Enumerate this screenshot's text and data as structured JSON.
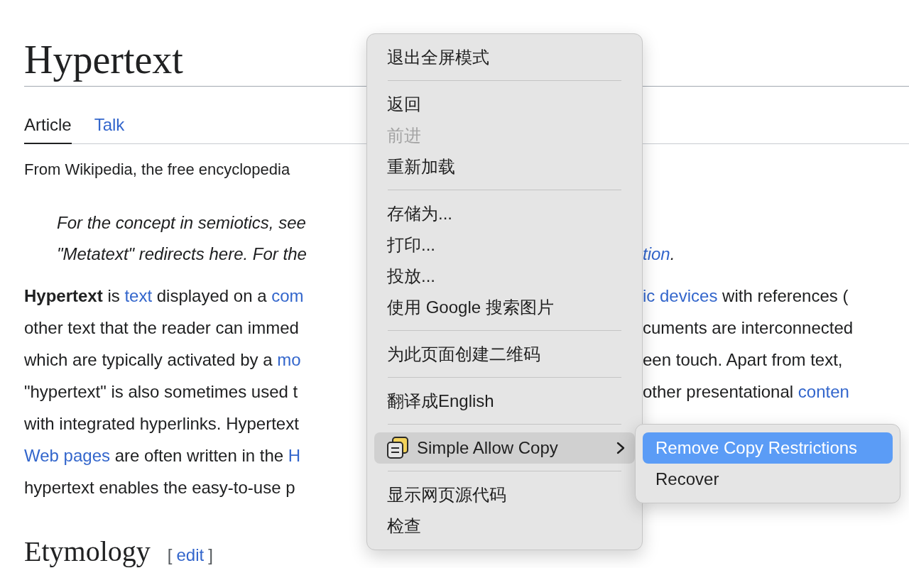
{
  "article": {
    "title": "Hypertext",
    "tabs": [
      {
        "label": "Article",
        "selected": true
      },
      {
        "label": "Talk",
        "selected": false
      }
    ],
    "tagline": "From Wikipedia, the free encyclopedia",
    "hatnote_lines": [
      {
        "left": [
          {
            "kind": "plain",
            "text": "For the concept in semiotics, see"
          }
        ]
      },
      {
        "left": [
          {
            "kind": "plain",
            "text": "\"Metatext\" redirects here. For the"
          }
        ],
        "right": [
          {
            "kind": "link",
            "text": "tion"
          },
          {
            "kind": "plain",
            "text": "."
          }
        ]
      }
    ],
    "paragraph_lines": [
      {
        "left": [
          {
            "kind": "bold",
            "text": "Hypertext"
          },
          {
            "kind": "plain",
            "text": " is "
          },
          {
            "kind": "link",
            "text": "text"
          },
          {
            "kind": "plain",
            "text": " displayed on a "
          },
          {
            "kind": "link",
            "text": "com"
          }
        ],
        "right": [
          {
            "kind": "link",
            "text": "ic devices"
          },
          {
            "kind": "plain",
            "text": " with references ("
          }
        ]
      },
      {
        "left": [
          {
            "kind": "plain",
            "text": "other text that the reader can immed"
          }
        ],
        "right": [
          {
            "kind": "plain",
            "text": "cuments are interconnected"
          }
        ]
      },
      {
        "left": [
          {
            "kind": "plain",
            "text": "which are typically activated by a "
          },
          {
            "kind": "link",
            "text": "mo"
          }
        ],
        "right": [
          {
            "kind": "plain",
            "text": "een touch. Apart from text,"
          }
        ]
      },
      {
        "left": [
          {
            "kind": "plain",
            "text": "\"hypertext\" is also sometimes used t"
          }
        ],
        "right": [
          {
            "kind": "plain",
            "text": "other presentational "
          },
          {
            "kind": "link",
            "text": "conten"
          }
        ]
      },
      {
        "left": [
          {
            "kind": "plain",
            "text": "with integrated hyperlinks. Hypertext"
          }
        ]
      },
      {
        "left": [
          {
            "kind": "link",
            "text": "Web pages"
          },
          {
            "kind": "plain",
            "text": " are often written in the "
          },
          {
            "kind": "link",
            "text": "H"
          }
        ]
      },
      {
        "left": [
          {
            "kind": "plain",
            "text": "hypertext enables the easy-to-use p"
          }
        ]
      }
    ],
    "section": {
      "heading": "Etymology",
      "edit_open": "[",
      "edit_link": "edit",
      "edit_close": "]"
    }
  },
  "context_menu": {
    "groups": [
      [
        {
          "kind": "action",
          "label": "退出全屏模式",
          "disabled": false,
          "selected": false
        }
      ],
      [
        {
          "kind": "action",
          "label": "返回",
          "disabled": false,
          "selected": false
        },
        {
          "kind": "action",
          "label": "前进",
          "disabled": true,
          "selected": false
        },
        {
          "kind": "action",
          "label": "重新加载",
          "disabled": false,
          "selected": false
        }
      ],
      [
        {
          "kind": "action",
          "label": "存储为...",
          "disabled": false,
          "selected": false
        },
        {
          "kind": "action",
          "label": "打印...",
          "disabled": false,
          "selected": false
        },
        {
          "kind": "action",
          "label": "投放...",
          "disabled": false,
          "selected": false
        },
        {
          "kind": "action",
          "label": "使用 Google 搜索图片",
          "disabled": false,
          "selected": false
        }
      ],
      [
        {
          "kind": "action",
          "label": "为此页面创建二维码",
          "disabled": false,
          "selected": false
        }
      ],
      [
        {
          "kind": "action",
          "label": "翻译成English",
          "disabled": false,
          "selected": false
        }
      ],
      [
        {
          "kind": "submenu",
          "label": "Simple Allow Copy",
          "disabled": false,
          "selected": true
        }
      ],
      [
        {
          "kind": "action",
          "label": "显示网页源代码",
          "disabled": false,
          "selected": false
        },
        {
          "kind": "action",
          "label": "检查",
          "disabled": false,
          "selected": false
        }
      ]
    ]
  },
  "submenu": {
    "items": [
      {
        "label": "Remove Copy Restrictions",
        "selected": true
      },
      {
        "label": "Recover",
        "selected": false
      }
    ]
  }
}
